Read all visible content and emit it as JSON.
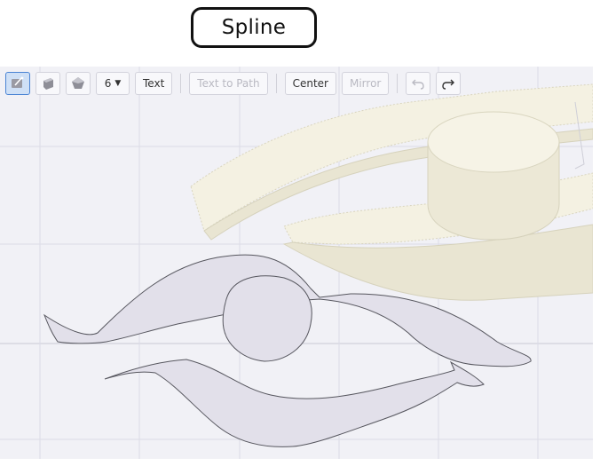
{
  "header": {
    "title": "Spline"
  },
  "toolbar": {
    "tools": [
      {
        "name": "draw-spline-tool",
        "icon": "spline-draw-icon",
        "active": true
      },
      {
        "name": "extrude-tool",
        "icon": "extrude-icon",
        "active": false
      },
      {
        "name": "pentagon-tool",
        "icon": "pentagon-icon",
        "active": false
      }
    ],
    "sides_value": "6",
    "text_label": "Text",
    "text_to_path_label": "Text to Path",
    "center_label": "Center",
    "mirror_label": "Mirror",
    "undo_icon": "undo-icon",
    "redo_icon": "redo-icon"
  },
  "colors": {
    "viewport_bg": "#f1f1f6",
    "grid_line": "#dcdce6",
    "shape_fill": "#e2e0ea",
    "shape_stroke": "#56565e",
    "extrusion_top": "#f4f1e2",
    "extrusion_side": "#e9e5d2",
    "active_tool": "#cfe0f6"
  }
}
